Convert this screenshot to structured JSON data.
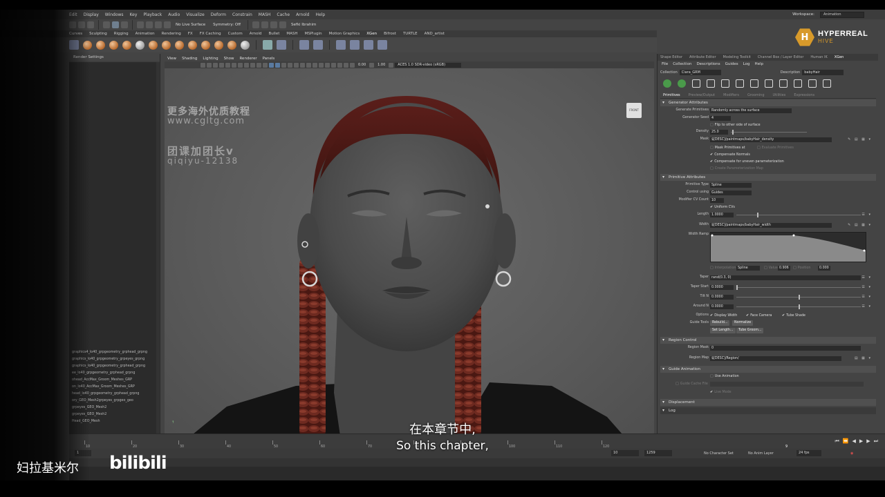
{
  "menubar": {
    "items": [
      "Edit",
      "Display",
      "Windows",
      "Key",
      "Playback",
      "Audio",
      "Visualize",
      "Deform",
      "Constrain",
      "MASH",
      "Cache",
      "Arnold",
      "Help"
    ]
  },
  "workspace": {
    "label": "Workspace:",
    "value": "Animation"
  },
  "statusline": {
    "surface": "No Live Surface",
    "symmetry": "Symmetry: Off",
    "user": "Sefki Ibrahim"
  },
  "shelf": {
    "tabs": [
      "Curves",
      "Sculpting",
      "Rigging",
      "Animation",
      "Rendering",
      "FX",
      "FX Caching",
      "Custom",
      "Arnold",
      "Bullet",
      "MASH",
      "MSPlugin",
      "Motion Graphics",
      "XGen",
      "Bifrost",
      "TURTLE",
      "AND_artist"
    ],
    "active_tab": "XGen"
  },
  "outliner": {
    "header": "Render Settings",
    "items": [
      "graphics4_lo40_grpgeometry_grphead_grpng",
      "graphics_lo40_grpgeometry_grpeyes_grpng",
      "graphics_Io40_grpgeometry_grphead_grpng",
      "ee_lo40_grpgeometry_grphead_grpng",
      "ohead_AccMax_Groom_Meshes_GRP",
      "on_lo40_AccMax_Groom_Meshes_GRP",
      "head_lo40_grpgeometry_grphead_grpng",
      "ory_GEO_Mesh2grpeyes_grpgeo_geo",
      "grpeyes_GEO_Mesh2",
      "grpeyes_GEO_Mesh2",
      "Head_GEO_Mesh"
    ]
  },
  "viewport": {
    "menu": [
      "View",
      "Shading",
      "Lighting",
      "Show",
      "Renderer",
      "Panels"
    ],
    "exposure": "0.00",
    "gamma": "1.00",
    "colorspace": "ACES 1.0 SDR-video (sRGB)",
    "cube_label": "FRONT",
    "watermark": {
      "line1": "更多海外优质教程",
      "line2": "www.cgltg.com",
      "line3": "团课加团长v",
      "line4": "qiqiyu-12138"
    }
  },
  "right_panel": {
    "tabs": [
      "Shape Editor",
      "Attribute Editor",
      "Modeling Toolkit",
      "Channel Box / Layer Editor",
      "Human IK",
      "XGen"
    ],
    "active_tab": "XGen",
    "menu": [
      "File",
      "Collection",
      "Descriptions",
      "Guides",
      "Log",
      "Help"
    ],
    "collection_label": "Collection",
    "collection_value": "Ciara_GRM",
    "description_label": "Description",
    "description_value": "babyHair",
    "subtabs": [
      "Primitives",
      "Preview/Output",
      "Modifiers",
      "Grooming",
      "Utilities",
      "Expressions"
    ],
    "active_subtab": "Primitives",
    "generator": {
      "header": "Generator Attributes",
      "generate_primitives_label": "Generate Primitives",
      "generate_primitives_value": "Randomly across the surface",
      "seed_label": "Generator Seed",
      "seed_value": "4",
      "flip_label": "Flip to other side of surface",
      "density_label": "Density",
      "density_value": "25.0",
      "mask_label": "Mask",
      "mask_value": "$[DESC]/paintmaps/babyHair_density",
      "mask_prims_label": "Mask Primitives at",
      "mask_prims_value": "Evaluate Primitives",
      "compensate_normals_label": "Compensate Normals",
      "compensate_param_label": "Compensate for uneven parameterization",
      "create_maps_label": "Create Parameterization Map"
    },
    "primitive": {
      "header": "Primitive Attributes",
      "type_label": "Primitive Type",
      "type_value": "Spline",
      "control_label": "Control using",
      "control_value": "Guides",
      "cv_label": "Modifier CV Count",
      "cv_value": "10",
      "uniform_label": "Uniform CVs",
      "length_label": "Length",
      "length_value": "1.0000",
      "width_label": "Width",
      "width_value": "$[DESC]/paintmaps/babyHair_width",
      "ramp_label": "Width Ramp",
      "interp_label": "Interpolation",
      "interp_value": "Spline",
      "value_label": "Value",
      "value_value": "0.906",
      "position_label": "Position",
      "position_value": "0.000",
      "taper_label": "Taper",
      "taper_value": "rand(0.3, 0)",
      "taper_start_label": "Taper Start",
      "taper_start_value": "0.0000",
      "tilt_label": "Tilt N",
      "tilt_value": "0.0000",
      "around_label": "Around N",
      "around_value": "0.0000",
      "options_label": "Options",
      "display_width": "Display Width",
      "face_camera": "Face Camera",
      "tube_shade": "Tube Shade",
      "guide_tools_label": "Guide Tools",
      "rebuild": "Rebuild...",
      "normalize": "Normalize",
      "set_length": "Set Length...",
      "tube_groom": "Tube Groom..."
    },
    "region": {
      "header": "Region Control",
      "mask_label": "Region Mask",
      "mask_value": "0",
      "map_label": "Region Map",
      "map_value": "$[DESC]/Region/"
    },
    "guide_anim": {
      "header": "Guide Animation",
      "use_label": "Use Animation",
      "live_label": "Live Mode",
      "cache_label": "Guide Cache File"
    },
    "displacement_header": "Displacement",
    "log_label": "Log"
  },
  "timeslider": {
    "ticks": [
      "10",
      "20",
      "30",
      "40",
      "50",
      "60",
      "70",
      "80",
      "90",
      "100",
      "110",
      "120"
    ],
    "current": "9"
  },
  "rangebar": {
    "start": "1",
    "end": "10",
    "range_end": "1259",
    "character_set": "No Character Set",
    "anim_layer": "No Anim Layer",
    "fps": "24 fps"
  },
  "overlay": {
    "logo_line1": "HYPERREAL",
    "logo_line2": "HIVE",
    "subtitle_cn": "在本章节中,",
    "subtitle_en": "So this chapter,",
    "uploader": "妇拉基米尔",
    "platform": "bilibili"
  }
}
